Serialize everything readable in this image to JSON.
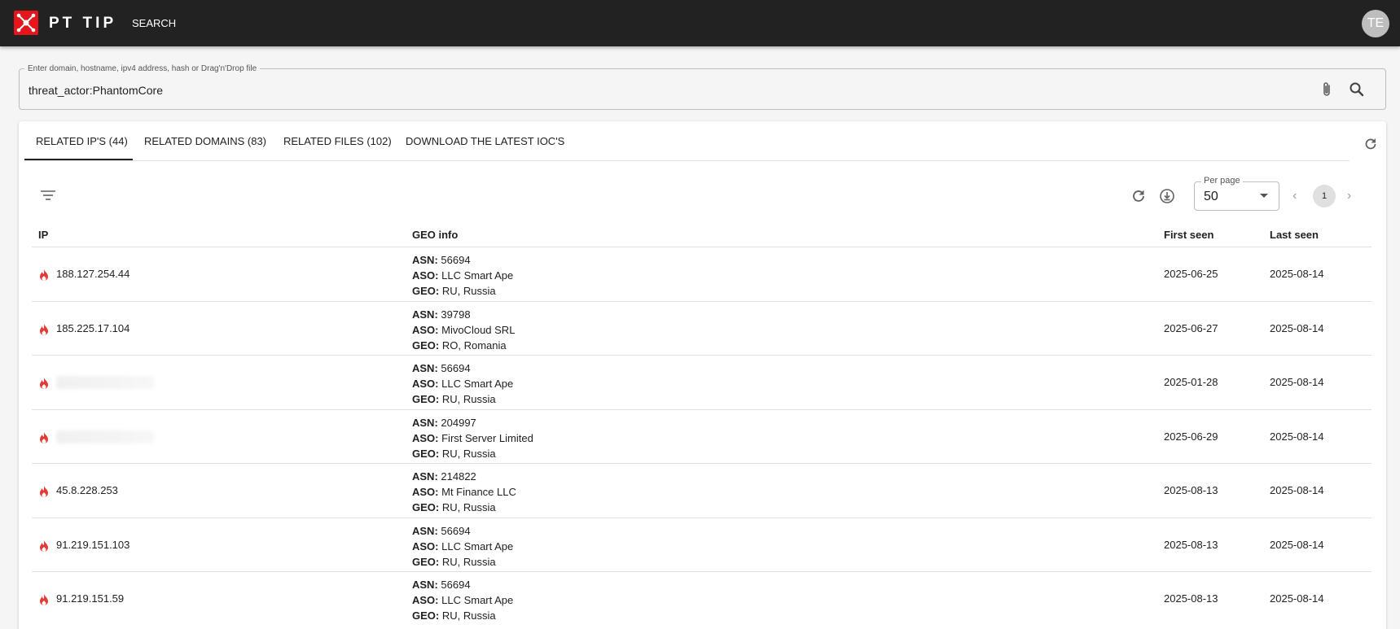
{
  "app": {
    "brand": "PT TIP",
    "nav_search": "SEARCH",
    "avatar_initials": "TE"
  },
  "search": {
    "label": "Enter domain, hostname, ipv4 address, hash or Drag'n'Drop file",
    "value": "threat_actor:PhantomCore"
  },
  "tabs": [
    {
      "label": "RELATED IP'S (44)",
      "active": true
    },
    {
      "label": "RELATED DOMAINS (83)",
      "active": false
    },
    {
      "label": "RELATED FILES (102)",
      "active": false
    },
    {
      "label": "DOWNLOAD THE LATEST IOC'S",
      "active": false
    }
  ],
  "toolbar": {
    "per_page_label": "Per page",
    "per_page_value": "50",
    "current_page": "1"
  },
  "table": {
    "headers": {
      "ip": "IP",
      "geo": "GEO info",
      "first_seen": "First seen",
      "last_seen": "Last seen"
    },
    "geo_keys": {
      "asn": "ASN:",
      "aso": "ASO:",
      "geo": "GEO:"
    },
    "rows": [
      {
        "ip": "188.127.254.44",
        "blurred": false,
        "asn": "56694",
        "aso": "LLC Smart Ape",
        "geo": "RU, Russia",
        "first_seen": "2025-06-25",
        "last_seen": "2025-08-14"
      },
      {
        "ip": "185.225.17.104",
        "blurred": false,
        "asn": "39798",
        "aso": "MivoCloud SRL",
        "geo": "RO, Romania",
        "first_seen": "2025-06-27",
        "last_seen": "2025-08-14"
      },
      {
        "ip": "",
        "blurred": true,
        "asn": "56694",
        "aso": "LLC Smart Ape",
        "geo": "RU, Russia",
        "first_seen": "2025-01-28",
        "last_seen": "2025-08-14"
      },
      {
        "ip": "",
        "blurred": true,
        "asn": "204997",
        "aso": "First Server Limited",
        "geo": "RU, Russia",
        "first_seen": "2025-06-29",
        "last_seen": "2025-08-14"
      },
      {
        "ip": "45.8.228.253",
        "blurred": false,
        "asn": "214822",
        "aso": "Mt Finance LLC",
        "geo": "RU, Russia",
        "first_seen": "2025-08-13",
        "last_seen": "2025-08-14"
      },
      {
        "ip": "91.219.151.103",
        "blurred": false,
        "asn": "56694",
        "aso": "LLC Smart Ape",
        "geo": "RU, Russia",
        "first_seen": "2025-08-13",
        "last_seen": "2025-08-14"
      },
      {
        "ip": "91.219.151.59",
        "blurred": false,
        "asn": "56694",
        "aso": "LLC Smart Ape",
        "geo": "RU, Russia",
        "first_seen": "2025-08-13",
        "last_seen": "2025-08-14"
      }
    ]
  },
  "colors": {
    "topbar": "#222222",
    "logo": "#e8141b",
    "fire_icon": "#e53935"
  }
}
